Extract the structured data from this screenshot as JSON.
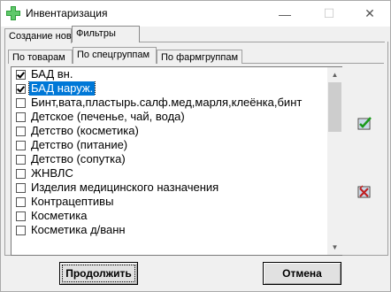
{
  "window": {
    "title": "Инвентаризация",
    "caption_min": "—",
    "caption_max": "☐",
    "caption_close": "✕"
  },
  "tabs_top": [
    "Создание новой",
    "Фильтры"
  ],
  "tabs_sub": [
    "По товарам",
    "По спецгруппам",
    "По фармгруппам"
  ],
  "list": {
    "items": [
      {
        "label": "БАД вн.",
        "checked": true,
        "selected": false
      },
      {
        "label": "БАД наруж.",
        "checked": true,
        "selected": true
      },
      {
        "label": "Бинт,вата,пластырь.салф.мед,марля,клеёнка,бинт",
        "checked": false,
        "selected": false
      },
      {
        "label": "Детское (печенье, чай, вода)",
        "checked": false,
        "selected": false
      },
      {
        "label": "Детство (косметика)",
        "checked": false,
        "selected": false
      },
      {
        "label": "Детство (питание)",
        "checked": false,
        "selected": false
      },
      {
        "label": "Детство (сопутка)",
        "checked": false,
        "selected": false
      },
      {
        "label": "ЖНВЛС",
        "checked": false,
        "selected": false
      },
      {
        "label": "Изделия медицинского назначения",
        "checked": false,
        "selected": false
      },
      {
        "label": "Контрацептивы",
        "checked": false,
        "selected": false
      },
      {
        "label": "Косметика",
        "checked": false,
        "selected": false
      },
      {
        "label": "Косметика д/ванн",
        "checked": false,
        "selected": false
      }
    ]
  },
  "icons": {
    "app": "green-cross-icon",
    "check_all": "check-all-icon",
    "uncheck_all": "uncheck-all-icon"
  },
  "buttons": {
    "continue": "Продолжить",
    "cancel": "Отмена"
  },
  "colors": {
    "selection": "#0078d7",
    "app_icon": "#2e9e3a"
  }
}
